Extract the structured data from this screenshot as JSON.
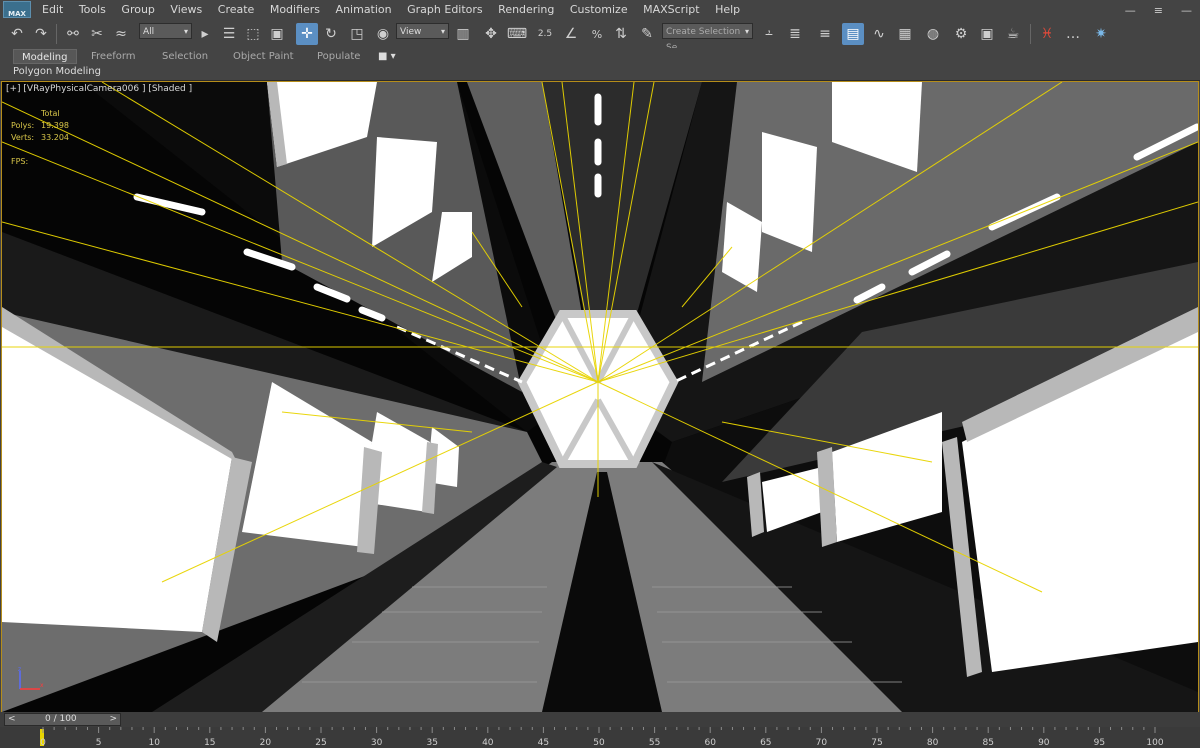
{
  "app": {
    "logo": "MAX"
  },
  "menu": [
    "Edit",
    "Tools",
    "Group",
    "Views",
    "Create",
    "Modifiers",
    "Animation",
    "Graph Editors",
    "Rendering",
    "Customize",
    "MAXScript",
    "Help"
  ],
  "toolbar": {
    "selection_filter": "All",
    "reference_coord": "View",
    "named_selection_placeholder": "Create Selection Se",
    "snap_label": "2.5"
  },
  "ribbon": {
    "tabs": [
      "Modeling",
      "Freeform",
      "Selection",
      "Object Paint",
      "Populate"
    ],
    "active_tab": "Modeling",
    "panel_label": "Polygon Modeling"
  },
  "viewport": {
    "label": "[+] [VRayPhysicalCamera006 ] [Shaded ]",
    "stats": {
      "total_label": "Total",
      "polys_label": "Polys:",
      "polys_value": "19.398",
      "verts_label": "Verts:",
      "verts_value": "33.204",
      "fps_label": "FPS:"
    }
  },
  "timeline": {
    "frame_display": "0 / 100",
    "prev": "<",
    "next": ">",
    "ticks": [
      "0",
      "5",
      "10",
      "15",
      "20",
      "25",
      "30",
      "35",
      "40",
      "45",
      "50",
      "55",
      "60",
      "65",
      "70",
      "75",
      "80",
      "85",
      "90",
      "95",
      "100"
    ]
  },
  "colors": {
    "accent": "#5b8fc3",
    "helper_lines": "#e8d400",
    "viewport_border": "#b58d1a"
  }
}
